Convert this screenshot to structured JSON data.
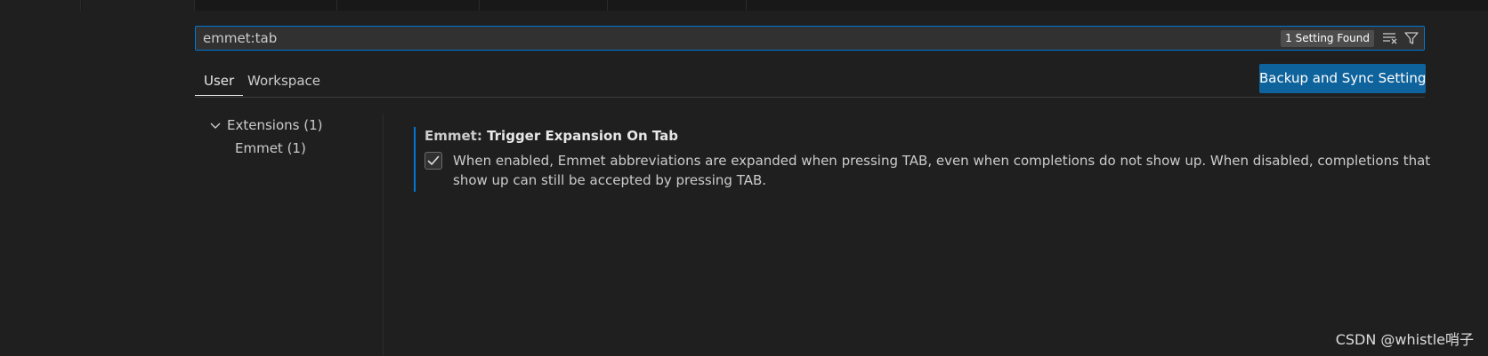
{
  "search": {
    "value": "emmet:tab",
    "result_count": "1 Setting Found",
    "clear_icon": "clear-filter-icon",
    "filter_icon": "filter-icon"
  },
  "scope_tabs": [
    {
      "label": "User",
      "active": true
    },
    {
      "label": "Workspace",
      "active": false
    }
  ],
  "sync_button": {
    "label": "Backup and Sync Settings"
  },
  "toc": {
    "group": {
      "label": "Extensions (1)",
      "expanded": true
    },
    "items": [
      {
        "label": "Emmet (1)"
      }
    ]
  },
  "setting": {
    "category": "Emmet: ",
    "name": "Trigger Expansion On Tab",
    "checked": true,
    "description": "When enabled, Emmet abbreviations are expanded when pressing TAB, even when completions do not show up. When disabled, completions that show up can still be accepted by pressing TAB."
  },
  "watermark": "CSDN @whistle哨子",
  "colors": {
    "background": "#1f1f1f",
    "accent": "#0078d4",
    "button": "#0e639c",
    "badge": "#4d4d4d"
  }
}
